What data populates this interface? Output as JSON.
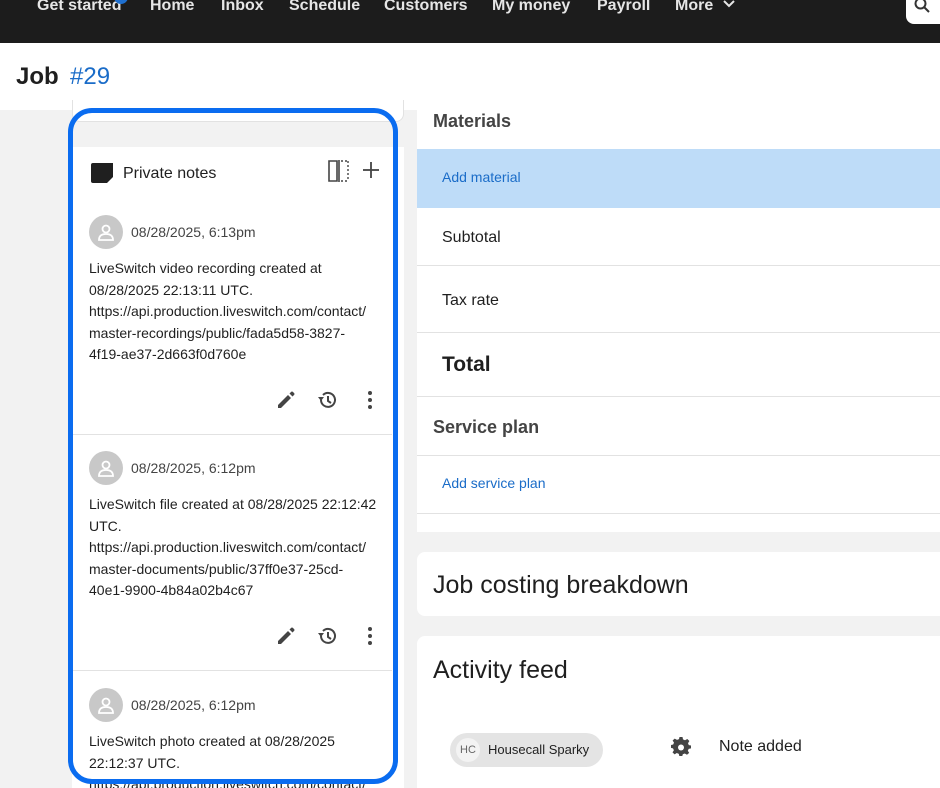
{
  "nav": {
    "items": [
      "Get started",
      "Home",
      "Inbox",
      "Schedule",
      "Customers",
      "My money",
      "Payroll",
      "More"
    ]
  },
  "job": {
    "title": "Job",
    "number": "#29"
  },
  "notes": {
    "title": "Private notes",
    "items": [
      {
        "timestamp": "08/28/2025, 6:13pm",
        "lines": [
          "LiveSwitch video recording created at",
          "08/28/2025 22:13:11 UTC.",
          "https://api.production.liveswitch.com/contact/",
          "master-recordings/public/fada5d58-3827-",
          "4f19-ae37-2d663f0d760e"
        ]
      },
      {
        "timestamp": "08/28/2025, 6:12pm",
        "lines": [
          "LiveSwitch file created at 08/28/2025 22:12:42",
          "UTC.",
          "https://api.production.liveswitch.com/contact/",
          "master-documents/public/37ff0e37-25cd-",
          "40e1-9900-4b84a02b4c67"
        ]
      },
      {
        "timestamp": "08/28/2025, 6:12pm",
        "lines": [
          "LiveSwitch photo created at 08/28/2025",
          "22:12:37 UTC.",
          "https://api.production.liveswitch.com/contact/"
        ]
      }
    ]
  },
  "materials": {
    "title": "Materials",
    "add_material": "Add material",
    "subtotal": "Subtotal",
    "tax_rate": "Tax rate",
    "total": "Total",
    "service_plan_title": "Service plan",
    "add_service_plan": "Add service plan"
  },
  "costing": {
    "title": "Job costing breakdown"
  },
  "activity": {
    "title": "Activity feed",
    "chip_initials": "HC",
    "chip_name": "Housecall Sparky",
    "event": "Note added"
  },
  "colors": {
    "nav_bg": "#1c1c1c",
    "accent": "#1a6cc8",
    "highlight_ring": "#0a6cf0",
    "selected_row": "#bedcf8"
  }
}
